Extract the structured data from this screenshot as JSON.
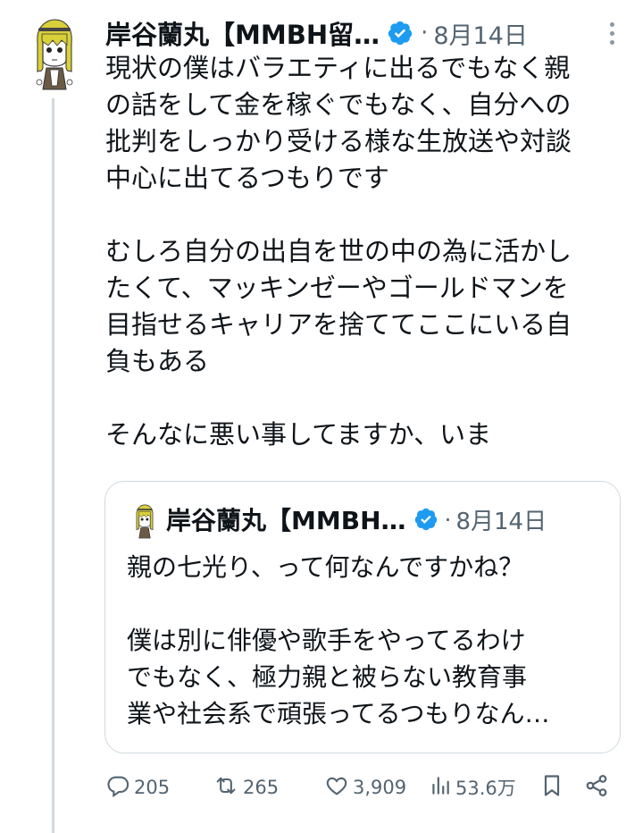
{
  "tweet": {
    "author_name": "岸谷蘭丸【MMBH留…",
    "separator": "·",
    "date": "8月14日",
    "text": "現状の僕はバラエティに出るでもなく親\nの話をして金を稼ぐでもなく、自分への\n批判をしっかり受ける様な生放送や対談\n中心に出てるつもりです\n\nむしろ自分の出自を世の中の為に活かし\nたくて、マッキンゼーやゴールドマンを\n目指せるキャリアを捨ててここにいる自\n負もある\n\nそんなに悪い事してますか、いま"
  },
  "quoted_tweet": {
    "author_name": "岸谷蘭丸【MMBH…",
    "separator": "·",
    "date": "8月14日",
    "text": "親の七光り、って何なんですかね？\n\n僕は別に俳優や歌手をやってるわけ\nでもなく、極力親と被らない教育事\n業や社会系で頑張ってるつもりなん…"
  },
  "actions": {
    "replies": "205",
    "reposts": "265",
    "likes": "3,909",
    "views": "53.6万"
  },
  "colors": {
    "text": "#0f1419",
    "secondary": "#536471",
    "verified": "#1d9bf0",
    "border": "#cfd9de"
  },
  "icons": [
    "reply-icon",
    "repost-icon",
    "like-icon",
    "views-icon",
    "bookmark-icon",
    "share-icon",
    "verified-badge-icon",
    "more-icon"
  ]
}
